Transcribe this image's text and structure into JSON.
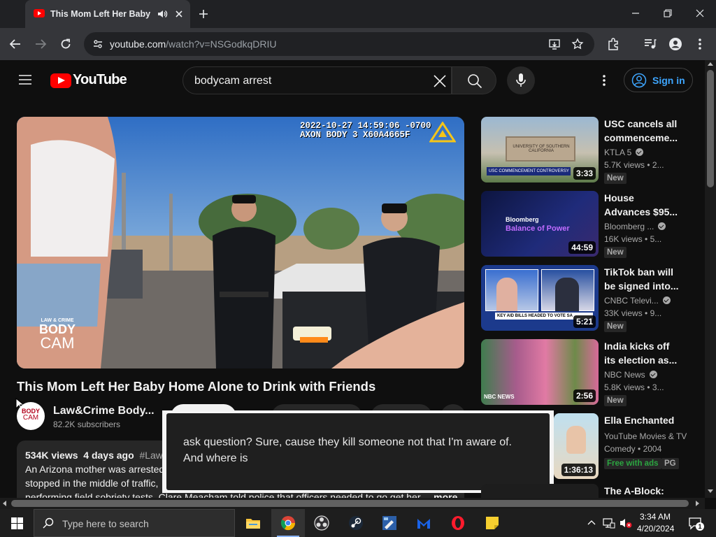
{
  "browser": {
    "tab_title": "This Mom Left Her Baby H",
    "url_host": "youtube.com",
    "url_path": "/watch?v=NSGodkqDRIU"
  },
  "youtube": {
    "logo_text": "YouTube",
    "search_query": "bodycam arrest",
    "signin_label": "Sign in"
  },
  "video": {
    "overlay_timestamp": "2022-10-27 14:59:06 -0700",
    "overlay_device": "AXON BODY 3 X60A4665F",
    "watermark_top": "LAW & CRIME",
    "watermark_body": "BODY",
    "watermark_cam": "CAM",
    "title": "This Mom Left Her Baby Home Alone to Drink with Friends",
    "channel_name": "Law&Crime Body...",
    "channel_subs": "82.2K subscribers",
    "avatar_line1": "BODY",
    "avatar_line2": "CAM",
    "views": "534K views",
    "age": "4 days ago",
    "hashtag": "#Lawa",
    "desc_line1": "An Arizona mother was arrested",
    "desc_line2": "stopped in the middle of traffic,",
    "desc_line3": "performing field sobriety tests. Clare Meacham told police that officers needed to go get her...",
    "more": "more"
  },
  "caption": {
    "line1": "ask question? Sure, cause they kill someone not that I'm aware of.",
    "line2": "And where is"
  },
  "recommendations": [
    {
      "title1": "USC cancels all",
      "title2": "commenceme...",
      "channel": "KTLA 5",
      "views": "5.7K views",
      "age": "2...",
      "badge": "New",
      "duration": "3:33",
      "thumb_text": "UNIVERSITY OF SOUTHERN CALIFORNIA",
      "thumb_banner": "USC COMMENCEMENT CONTROVERSY"
    },
    {
      "title1": "House",
      "title2": "Advances $95...",
      "channel": "Bloomberg ...",
      "views": "16K views",
      "age": "5...",
      "badge": "New",
      "duration": "44:59",
      "thumb_text": "Bloomberg",
      "thumb_banner": "Balance of Power"
    },
    {
      "title1": "TikTok ban will",
      "title2": "be signed into...",
      "channel": "CNBC Televi...",
      "views": "33K views",
      "age": "9...",
      "badge": "New",
      "duration": "5:21",
      "thumb_banner": "KEY AID BILLS HEADED TO VOTE SA"
    },
    {
      "title1": "India kicks off",
      "title2": "its election as...",
      "channel": "NBC News",
      "views": "5.8K views",
      "age": "3...",
      "badge": "New",
      "duration": "2:56",
      "thumb_text": "NBC NEWS"
    },
    {
      "title1": "Ella Enchanted",
      "title2": "",
      "channel": "YouTube Movies & TV",
      "views": "Comedy",
      "age": "2004",
      "badge": "Free with ads",
      "badge2": "PG",
      "duration": "1:36:13"
    },
    {
      "title1": "The A-Block:",
      "title2": "",
      "channel": "",
      "views": "",
      "age": "",
      "badge": "",
      "duration": ""
    }
  ],
  "taskbar": {
    "search_placeholder": "Type here to search",
    "time": "3:34 AM",
    "date": "4/20/2024",
    "notification_count": "1"
  }
}
